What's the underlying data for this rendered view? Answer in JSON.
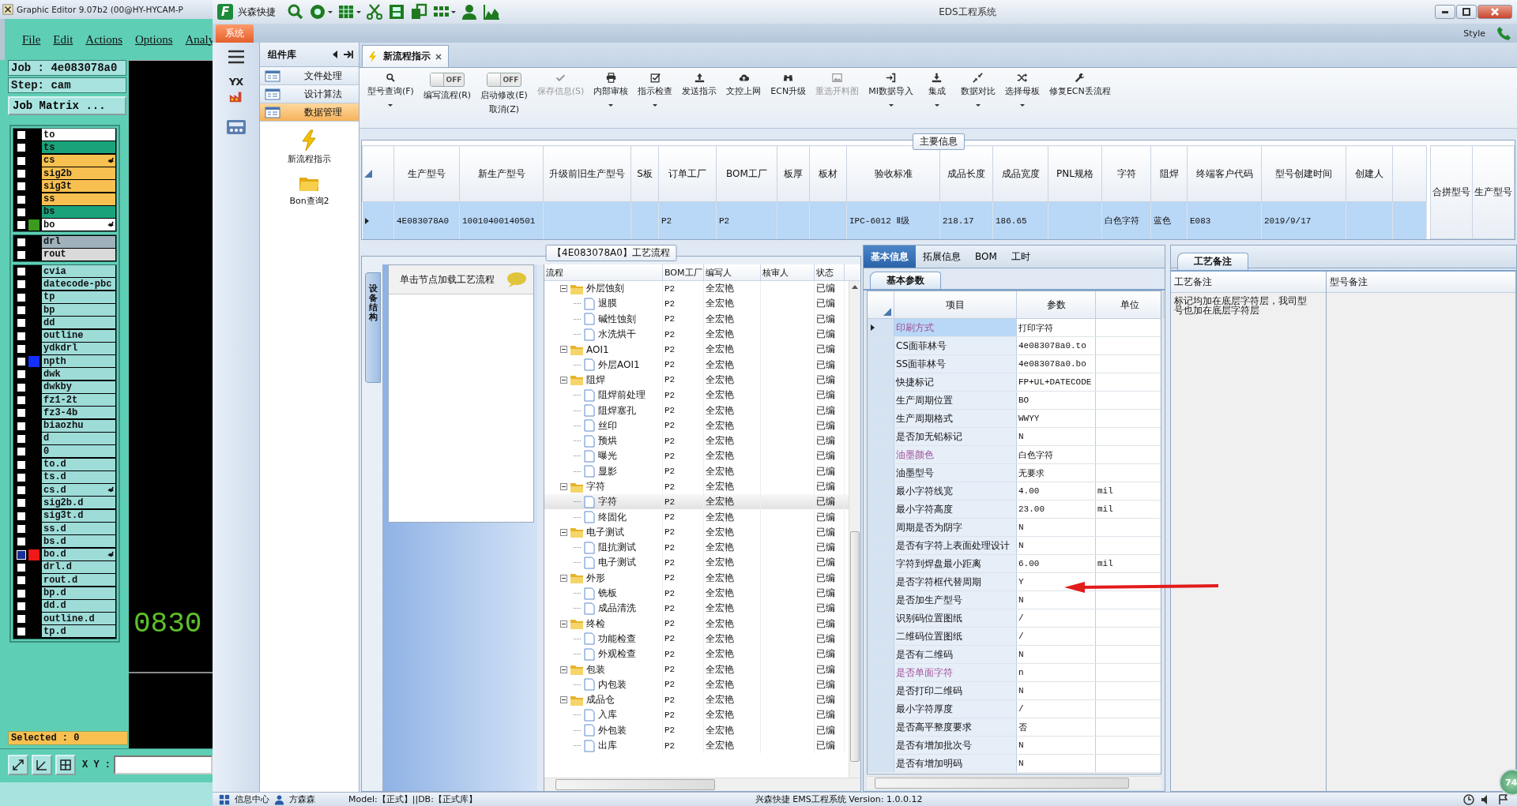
{
  "editor": {
    "title": "Graphic Editor 9.07b2 (00@HY-HYCAM-P",
    "menu": [
      "File",
      "Edit",
      "Actions",
      "Options",
      "Analy"
    ],
    "job": "Job : 4e083078a0",
    "step": "Step: cam",
    "matrix_button": "Job Matrix ...",
    "layer_groups": [
      {
        "layers": [
          {
            "name": "to",
            "color": "#ffffff",
            "hand": false,
            "selected": false
          },
          {
            "name": "ts",
            "color": "#1aa37a",
            "hand": false,
            "selected": false
          },
          {
            "name": "cs",
            "color": "#f8c050",
            "hand": true,
            "selected": false
          },
          {
            "name": "sig2b",
            "color": "#f8c050",
            "hand": false,
            "selected": false
          },
          {
            "name": "sig3t",
            "color": "#f8c050",
            "hand": false,
            "selected": false
          },
          {
            "name": "ss",
            "color": "#f8c050",
            "hand": false,
            "selected": false
          },
          {
            "name": "bs",
            "color": "#1aa37a",
            "hand": false,
            "selected": false
          },
          {
            "name": "bo",
            "color": "#ffffff",
            "hand": true,
            "selected": false,
            "marker": {
              "color": "#3c9a1e"
            }
          }
        ]
      },
      {
        "layers": [
          {
            "name": "drl",
            "color": "#9fb2bb",
            "hand": false,
            "selected": false
          },
          {
            "name": "rout",
            "color": "#d9d9d9",
            "hand": false,
            "selected": false
          }
        ]
      },
      {
        "layers": [
          {
            "name": "cvia",
            "color": "#9edcd8",
            "hand": false,
            "selected": false
          },
          {
            "name": "datecode-pbc",
            "color": "#9edcd8",
            "hand": false,
            "selected": false
          },
          {
            "name": "tp",
            "color": "#9edcd8",
            "hand": false,
            "selected": false
          },
          {
            "name": "bp",
            "color": "#9edcd8",
            "hand": false,
            "selected": false
          },
          {
            "name": "dd",
            "color": "#9edcd8",
            "hand": false,
            "selected": false
          },
          {
            "name": "outline",
            "color": "#9edcd8",
            "hand": false,
            "selected": false
          },
          {
            "name": "ydkdrl",
            "color": "#9edcd8",
            "hand": false,
            "selected": false
          },
          {
            "name": "npth",
            "color": "#9edcd8",
            "hand": false,
            "selected": false,
            "marker": {
              "color": "#1430ff"
            }
          },
          {
            "name": "dwk",
            "color": "#9edcd8",
            "hand": false,
            "selected": false
          },
          {
            "name": "dwkby",
            "color": "#9edcd8",
            "hand": false,
            "selected": false
          },
          {
            "name": "fz1-2t",
            "color": "#9edcd8",
            "hand": false,
            "selected": false
          },
          {
            "name": "fz3-4b",
            "color": "#9edcd8",
            "hand": false,
            "selected": false
          },
          {
            "name": "biaozhu",
            "color": "#9edcd8",
            "hand": false,
            "selected": false
          },
          {
            "name": "d",
            "color": "#9edcd8",
            "hand": false,
            "selected": false
          },
          {
            "name": "0",
            "color": "#9edcd8",
            "hand": false,
            "selected": false
          },
          {
            "name": "to.d",
            "color": "#9edcd8",
            "hand": false,
            "selected": false
          },
          {
            "name": "ts.d",
            "color": "#9edcd8",
            "hand": false,
            "selected": false
          },
          {
            "name": "cs.d",
            "color": "#9edcd8",
            "hand": true,
            "selected": false
          },
          {
            "name": "sig2b.d",
            "color": "#9edcd8",
            "hand": false,
            "selected": false
          },
          {
            "name": "sig3t.d",
            "color": "#9edcd8",
            "hand": false,
            "selected": false
          },
          {
            "name": "ss.d",
            "color": "#9edcd8",
            "hand": false,
            "selected": false
          },
          {
            "name": "bs.d",
            "color": "#9edcd8",
            "hand": false,
            "selected": false
          },
          {
            "name": "bo.d",
            "color": "#9edcd8",
            "hand": true,
            "selected": true,
            "marker": {
              "color": "#f01818"
            }
          },
          {
            "name": "drl.d",
            "color": "#9edcd8",
            "hand": false,
            "selected": false
          },
          {
            "name": "rout.d",
            "color": "#9edcd8",
            "hand": false,
            "selected": false
          },
          {
            "name": "bp.d",
            "color": "#9edcd8",
            "hand": false,
            "selected": false
          },
          {
            "name": "dd.d",
            "color": "#9edcd8",
            "hand": false,
            "selected": false
          },
          {
            "name": "outline.d",
            "color": "#9edcd8",
            "hand": false,
            "selected": false
          },
          {
            "name": "tp.d",
            "color": "#9edcd8",
            "hand": false,
            "selected": false
          }
        ]
      }
    ],
    "canvas_text": "0830",
    "selected_count": "Selected : 0",
    "xy_label": "X Y :"
  },
  "window": {
    "logo": "F",
    "app_name": "兴森快捷",
    "title": "EDS工程系统",
    "system_tab": "系统",
    "style_menu": "Style"
  },
  "nav": {
    "logo_text": "YX"
  },
  "component_library": {
    "title": "组件库",
    "items": [
      {
        "label": "文件处理",
        "selected": false
      },
      {
        "label": "设计算法",
        "selected": false
      },
      {
        "label": "数据管理",
        "selected": true
      }
    ],
    "shortcuts": [
      {
        "label": "新流程指示",
        "kind": "lightning"
      },
      {
        "label": "Bon查询2",
        "kind": "folder"
      }
    ]
  },
  "document_tab": {
    "label": "新流程指示"
  },
  "toolbar": {
    "items": [
      {
        "kind": "button",
        "label": "型号查询(F)",
        "dropdown": true,
        "disabled": false
      },
      {
        "kind": "toggle",
        "label": "编写流程(R)",
        "toggle_text": "OFF",
        "on": false
      },
      {
        "kind": "toggle",
        "label": "启动修改(E)",
        "sub_label": "取消(Z)",
        "toggle_text": "OFF",
        "on": false
      },
      {
        "kind": "button",
        "label": "保存信息(S)",
        "dropdown": false,
        "disabled": true
      },
      {
        "kind": "button",
        "label": "内部审核",
        "dropdown": true,
        "disabled": false
      },
      {
        "kind": "button",
        "label": "指示检查",
        "dropdown": true,
        "disabled": false
      },
      {
        "kind": "button",
        "label": "发送指示",
        "dropdown": false,
        "disabled": false
      },
      {
        "kind": "button",
        "label": "文控上网",
        "dropdown": false,
        "disabled": false
      },
      {
        "kind": "button",
        "label": "ECN升级",
        "dropdown": false,
        "disabled": false
      },
      {
        "kind": "button",
        "label": "重选开料图",
        "dropdown": false,
        "disabled": true
      },
      {
        "kind": "button",
        "label": "MI数据导入",
        "dropdown": true,
        "disabled": false
      },
      {
        "kind": "button",
        "label": "集成",
        "dropdown": true,
        "disabled": false
      },
      {
        "kind": "button",
        "label": "数据对比",
        "dropdown": true,
        "disabled": false
      },
      {
        "kind": "button",
        "label": "选择母板",
        "dropdown": true,
        "disabled": false
      },
      {
        "kind": "button",
        "label": "修复ECN丢流程",
        "dropdown": false,
        "disabled": false
      }
    ]
  },
  "main_info": {
    "title": "主要信息",
    "columns": [
      "生产型号",
      "新生产型号",
      "升级前旧生产型号",
      "S板",
      "订单工厂",
      "BOM工厂",
      "板厚",
      "板材",
      "验收标准",
      "成品长度",
      "成品宽度",
      "PNL规格",
      "字符",
      "阻焊",
      "终端客户代码",
      "型号创建时间",
      "创建人"
    ],
    "rows": [
      {
        "selected": true,
        "cells": [
          "4E083078A0",
          "10010400140501",
          null,
          null,
          "P2",
          "P2",
          null,
          null,
          "IPC-6012 Ⅱ级",
          "218.17",
          "186.65",
          null,
          "白色字符",
          "蓝色",
          "E083",
          "2019/9/17",
          null
        ]
      }
    ],
    "side_columns": [
      "合拼型号",
      "生产型号"
    ]
  },
  "process": {
    "title": "【4E083078A0】工艺流程",
    "side_tab": "设备结构",
    "hint": "单击节点加载工艺流程",
    "columns": [
      "流程",
      "BOM工厂",
      "编写人",
      "核审人",
      "状态"
    ],
    "tree": [
      {
        "label": "外层蚀刻",
        "bom": "P2",
        "writer": "全宏艳",
        "status": "已编",
        "expanded": true,
        "selected": false,
        "children": [
          {
            "label": "退膜",
            "bom": "P2",
            "writer": "全宏艳",
            "status": "已编",
            "selected": false
          },
          {
            "label": "碱性蚀刻",
            "bom": "P2",
            "writer": "全宏艳",
            "status": "已编",
            "selected": false
          },
          {
            "label": "水洗烘干",
            "bom": "P2",
            "writer": "全宏艳",
            "status": "已编",
            "selected": false
          }
        ]
      },
      {
        "label": "AOI1",
        "bom": "P2",
        "writer": "全宏艳",
        "status": "已编",
        "expanded": true,
        "selected": false,
        "children": [
          {
            "label": "外层AOI1",
            "bom": "P2",
            "writer": "全宏艳",
            "status": "已编",
            "selected": false
          }
        ]
      },
      {
        "label": "阻焊",
        "bom": "P2",
        "writer": "全宏艳",
        "status": "已编",
        "expanded": true,
        "selected": false,
        "children": [
          {
            "label": "阻焊前处理",
            "bom": "P2",
            "writer": "全宏艳",
            "status": "已编",
            "selected": false
          },
          {
            "label": "阻焊塞孔",
            "bom": "P2",
            "writer": "全宏艳",
            "status": "已编",
            "selected": false
          },
          {
            "label": "丝印",
            "bom": "P2",
            "writer": "全宏艳",
            "status": "已编",
            "selected": false
          },
          {
            "label": "预烘",
            "bom": "P2",
            "writer": "全宏艳",
            "status": "已编",
            "selected": false
          },
          {
            "label": "曝光",
            "bom": "P2",
            "writer": "全宏艳",
            "status": "已编",
            "selected": false
          },
          {
            "label": "显影",
            "bom": "P2",
            "writer": "全宏艳",
            "status": "已编",
            "selected": false
          }
        ]
      },
      {
        "label": "字符",
        "bom": "P2",
        "writer": "全宏艳",
        "status": "已编",
        "expanded": true,
        "selected": false,
        "children": [
          {
            "label": "字符",
            "bom": "P2",
            "writer": "全宏艳",
            "status": "已编",
            "selected": true
          },
          {
            "label": "终固化",
            "bom": "P2",
            "writer": "全宏艳",
            "status": "已编",
            "selected": false
          }
        ]
      },
      {
        "label": "电子测试",
        "bom": "P2",
        "writer": "全宏艳",
        "status": "已编",
        "expanded": true,
        "selected": false,
        "children": [
          {
            "label": "阻抗测试",
            "bom": "P2",
            "writer": "全宏艳",
            "status": "已编",
            "selected": false
          },
          {
            "label": "电子测试",
            "bom": "P2",
            "writer": "全宏艳",
            "status": "已编",
            "selected": false
          }
        ]
      },
      {
        "label": "外形",
        "bom": "P2",
        "writer": "全宏艳",
        "status": "已编",
        "expanded": true,
        "selected": false,
        "children": [
          {
            "label": "铣板",
            "bom": "P2",
            "writer": "全宏艳",
            "status": "已编",
            "selected": false
          },
          {
            "label": "成品清洗",
            "bom": "P2",
            "writer": "全宏艳",
            "status": "已编",
            "selected": false
          }
        ]
      },
      {
        "label": "终检",
        "bom": "P2",
        "writer": "全宏艳",
        "status": "已编",
        "expanded": true,
        "selected": false,
        "children": [
          {
            "label": "功能检查",
            "bom": "P2",
            "writer": "全宏艳",
            "status": "已编",
            "selected": false
          },
          {
            "label": "外观检查",
            "bom": "P2",
            "writer": "全宏艳",
            "status": "已编",
            "selected": false
          }
        ]
      },
      {
        "label": "包装",
        "bom": "P2",
        "writer": "全宏艳",
        "status": "已编",
        "expanded": true,
        "selected": false,
        "children": [
          {
            "label": "内包装",
            "bom": "P2",
            "writer": "全宏艳",
            "status": "已编",
            "selected": false
          }
        ]
      },
      {
        "label": "成品仓",
        "bom": "P2",
        "writer": "全宏艳",
        "status": "已编",
        "expanded": true,
        "selected": false,
        "children": [
          {
            "label": "入库",
            "bom": "P2",
            "writer": "全宏艳",
            "status": "已编",
            "selected": false
          },
          {
            "label": "外包装",
            "bom": "P2",
            "writer": "全宏艳",
            "status": "已编",
            "selected": false
          },
          {
            "label": "出库",
            "bom": "P2",
            "writer": "全宏艳",
            "status": "已编",
            "selected": false
          }
        ]
      }
    ]
  },
  "detail_tabs": [
    {
      "label": "基本信息",
      "selected": true
    },
    {
      "label": "拓展信息",
      "selected": false
    },
    {
      "label": "BOM",
      "selected": false
    },
    {
      "label": "工时",
      "selected": false
    }
  ],
  "params": {
    "title": "基本参数",
    "columns": [
      "项目",
      "参数",
      "单位"
    ],
    "rows": [
      {
        "item": "印刷方式",
        "value": "打印字符",
        "emphasized": true,
        "selected": true
      },
      {
        "item": "CS面菲林号",
        "value": "4e083078a0.to",
        "emphasized": false,
        "selected": false
      },
      {
        "item": "SS面菲林号",
        "value": "4e083078a0.bo",
        "emphasized": false,
        "selected": false
      },
      {
        "item": "快捷标记",
        "value": "FP+UL+DATECODE",
        "emphasized": false,
        "selected": false
      },
      {
        "item": "生产周期位置",
        "value": "BO",
        "emphasized": false,
        "selected": false
      },
      {
        "item": "生产周期格式",
        "value": "WWYY",
        "emphasized": false,
        "selected": false
      },
      {
        "item": "是否加无铅标记",
        "value": "N",
        "emphasized": false,
        "selected": false
      },
      {
        "item": "油墨颜色",
        "value": "白色字符",
        "emphasized": true,
        "selected": false
      },
      {
        "item": "油墨型号",
        "value": "无要求",
        "emphasized": false,
        "selected": false
      },
      {
        "item": "最小字符线宽",
        "value": "4.00",
        "unit": "mil",
        "emphasized": false,
        "selected": false
      },
      {
        "item": "最小字符高度",
        "value": "23.00",
        "unit": "mil",
        "emphasized": false,
        "selected": false
      },
      {
        "item": "周期是否为阴字",
        "value": "N",
        "emphasized": false,
        "selected": false
      },
      {
        "item": "是否有字符上表面处理设计",
        "value": "N",
        "emphasized": false,
        "selected": false
      },
      {
        "item": "字符到焊盘最小距离",
        "value": "6.00",
        "unit": "mil",
        "emphasized": false,
        "selected": false
      },
      {
        "item": "是否字符框代替周期",
        "value": "Y",
        "emphasized": false,
        "selected": false
      },
      {
        "item": "是否加生产型号",
        "value": "N",
        "emphasized": false,
        "selected": false
      },
      {
        "item": "识别码位置图纸",
        "value": "/",
        "emphasized": false,
        "selected": false
      },
      {
        "item": "二维码位置图纸",
        "value": "/",
        "emphasized": false,
        "selected": false
      },
      {
        "item": "是否有二维码",
        "value": "N",
        "emphasized": false,
        "selected": false
      },
      {
        "item": "是否单面字符",
        "value": "n",
        "emphasized": true,
        "selected": false
      },
      {
        "item": "是否打印二维码",
        "value": "N",
        "emphasized": false,
        "selected": false
      },
      {
        "item": "最小字符厚度",
        "value": "/",
        "emphasized": false,
        "selected": false
      },
      {
        "item": "是否高平整度要求",
        "value": "否",
        "emphasized": false,
        "selected": false
      },
      {
        "item": "是否有增加批次号",
        "value": "N",
        "emphasized": false,
        "selected": false
      },
      {
        "item": "是否有增加明码",
        "value": "N",
        "emphasized": false,
        "selected": false
      }
    ]
  },
  "notes": {
    "title": "工艺备注",
    "columns": [
      "工艺备注",
      "型号备注"
    ],
    "process_note": "标记均加在底层字符层，我司型号也加在底层字符层"
  },
  "floating_badge": "74",
  "status_bar": {
    "info_center": "信息中心",
    "user": "方森森",
    "model": "Model:【正式】||DB:【正式库】",
    "version": "兴森快捷 EMS工程系统 Version: 1.0.0.12"
  }
}
